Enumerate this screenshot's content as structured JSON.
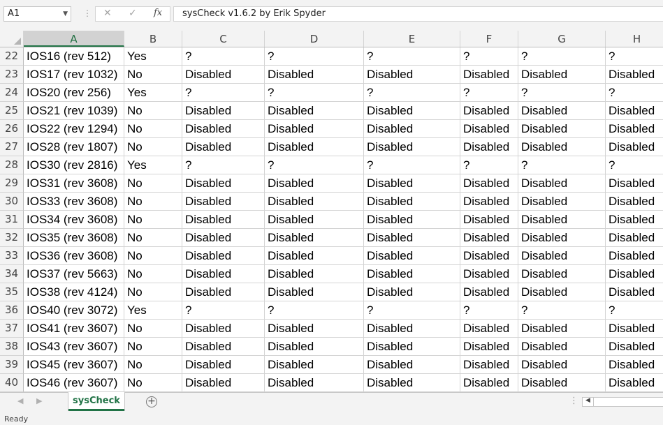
{
  "formula_bar": {
    "name_box": "A1",
    "cancel_glyph": "✕",
    "enter_glyph": "✓",
    "fx_glyph": "fx",
    "formula": "sysCheck v1.6.2 by Erik Spyder"
  },
  "columns": [
    "A",
    "B",
    "C",
    "D",
    "E",
    "F",
    "G",
    "H"
  ],
  "rows": [
    {
      "num": "22",
      "cells": [
        "IOS16 (rev 512)",
        "Yes",
        "?",
        "?",
        "?",
        "?",
        "?",
        "?"
      ]
    },
    {
      "num": "23",
      "cells": [
        "IOS17 (rev 1032)",
        "No",
        "Disabled",
        "Disabled",
        "Disabled",
        "Disabled",
        "Disabled",
        "Disabled"
      ]
    },
    {
      "num": "24",
      "cells": [
        "IOS20 (rev 256)",
        "Yes",
        "?",
        "?",
        "?",
        "?",
        "?",
        "?"
      ]
    },
    {
      "num": "25",
      "cells": [
        "IOS21 (rev 1039)",
        "No",
        "Disabled",
        "Disabled",
        "Disabled",
        "Disabled",
        "Disabled",
        "Disabled"
      ]
    },
    {
      "num": "26",
      "cells": [
        "IOS22 (rev 1294)",
        "No",
        "Disabled",
        "Disabled",
        "Disabled",
        "Disabled",
        "Disabled",
        "Disabled"
      ]
    },
    {
      "num": "27",
      "cells": [
        "IOS28 (rev 1807)",
        "No",
        "Disabled",
        "Disabled",
        "Disabled",
        "Disabled",
        "Disabled",
        "Disabled"
      ]
    },
    {
      "num": "28",
      "cells": [
        "IOS30 (rev 2816)",
        "Yes",
        "?",
        "?",
        "?",
        "?",
        "?",
        "?"
      ]
    },
    {
      "num": "29",
      "cells": [
        "IOS31 (rev 3608)",
        "No",
        "Disabled",
        "Disabled",
        "Disabled",
        "Disabled",
        "Disabled",
        "Disabled"
      ]
    },
    {
      "num": "30",
      "cells": [
        "IOS33 (rev 3608)",
        "No",
        "Disabled",
        "Disabled",
        "Disabled",
        "Disabled",
        "Disabled",
        "Disabled"
      ]
    },
    {
      "num": "31",
      "cells": [
        "IOS34 (rev 3608)",
        "No",
        "Disabled",
        "Disabled",
        "Disabled",
        "Disabled",
        "Disabled",
        "Disabled"
      ]
    },
    {
      "num": "32",
      "cells": [
        "IOS35 (rev 3608)",
        "No",
        "Disabled",
        "Disabled",
        "Disabled",
        "Disabled",
        "Disabled",
        "Disabled"
      ]
    },
    {
      "num": "33",
      "cells": [
        "IOS36 (rev 3608)",
        "No",
        "Disabled",
        "Disabled",
        "Disabled",
        "Disabled",
        "Disabled",
        "Disabled"
      ]
    },
    {
      "num": "34",
      "cells": [
        "IOS37 (rev 5663)",
        "No",
        "Disabled",
        "Disabled",
        "Disabled",
        "Disabled",
        "Disabled",
        "Disabled"
      ]
    },
    {
      "num": "35",
      "cells": [
        "IOS38 (rev 4124)",
        "No",
        "Disabled",
        "Disabled",
        "Disabled",
        "Disabled",
        "Disabled",
        "Disabled"
      ]
    },
    {
      "num": "36",
      "cells": [
        "IOS40 (rev 3072)",
        "Yes",
        "?",
        "?",
        "?",
        "?",
        "?",
        "?"
      ]
    },
    {
      "num": "37",
      "cells": [
        "IOS41 (rev 3607)",
        "No",
        "Disabled",
        "Disabled",
        "Disabled",
        "Disabled",
        "Disabled",
        "Disabled"
      ]
    },
    {
      "num": "38",
      "cells": [
        "IOS43 (rev 3607)",
        "No",
        "Disabled",
        "Disabled",
        "Disabled",
        "Disabled",
        "Disabled",
        "Disabled"
      ]
    },
    {
      "num": "39",
      "cells": [
        "IOS45 (rev 3607)",
        "No",
        "Disabled",
        "Disabled",
        "Disabled",
        "Disabled",
        "Disabled",
        "Disabled"
      ]
    },
    {
      "num": "40",
      "cells": [
        "IOS46 (rev 3607)",
        "No",
        "Disabled",
        "Disabled",
        "Disabled",
        "Disabled",
        "Disabled",
        "Disabled"
      ]
    }
  ],
  "sheet_tabs": {
    "active": "sysCheck",
    "add_glyph": "+"
  },
  "status": "Ready",
  "colors": {
    "accent": "#217346",
    "chrome": "#f3f3f3",
    "gridline": "#d4d4d4"
  }
}
